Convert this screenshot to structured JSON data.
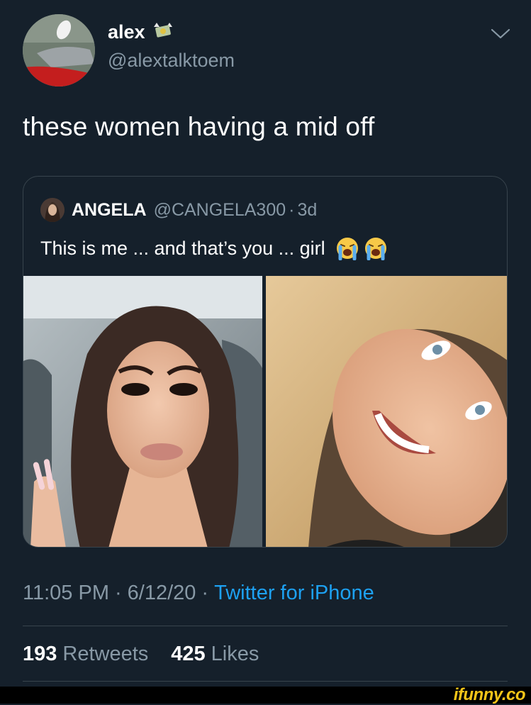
{
  "tweet": {
    "display_name": "alex",
    "handle": "@alextalktoem",
    "text": "these women having a mid off",
    "timestamp": "11:05 PM",
    "date": "6/12/20",
    "source": "Twitter for iPhone",
    "separator": "·"
  },
  "quoted_tweet": {
    "display_name": "ANGELA",
    "handle": "@CANGELA300",
    "age": "3d",
    "text": "This is me ... and that’s you ... girl",
    "emojis": [
      "loudly-crying-face",
      "loudly-crying-face"
    ]
  },
  "stats": {
    "retweets_count": "193",
    "retweets_label": "Retweets",
    "likes_count": "425",
    "likes_label": "Likes"
  },
  "watermark": "ifunny.co",
  "colors": {
    "background": "#15202b",
    "text_primary": "#ffffff",
    "text_secondary": "#8899a6",
    "link": "#1da1f2",
    "border": "#38444d"
  }
}
